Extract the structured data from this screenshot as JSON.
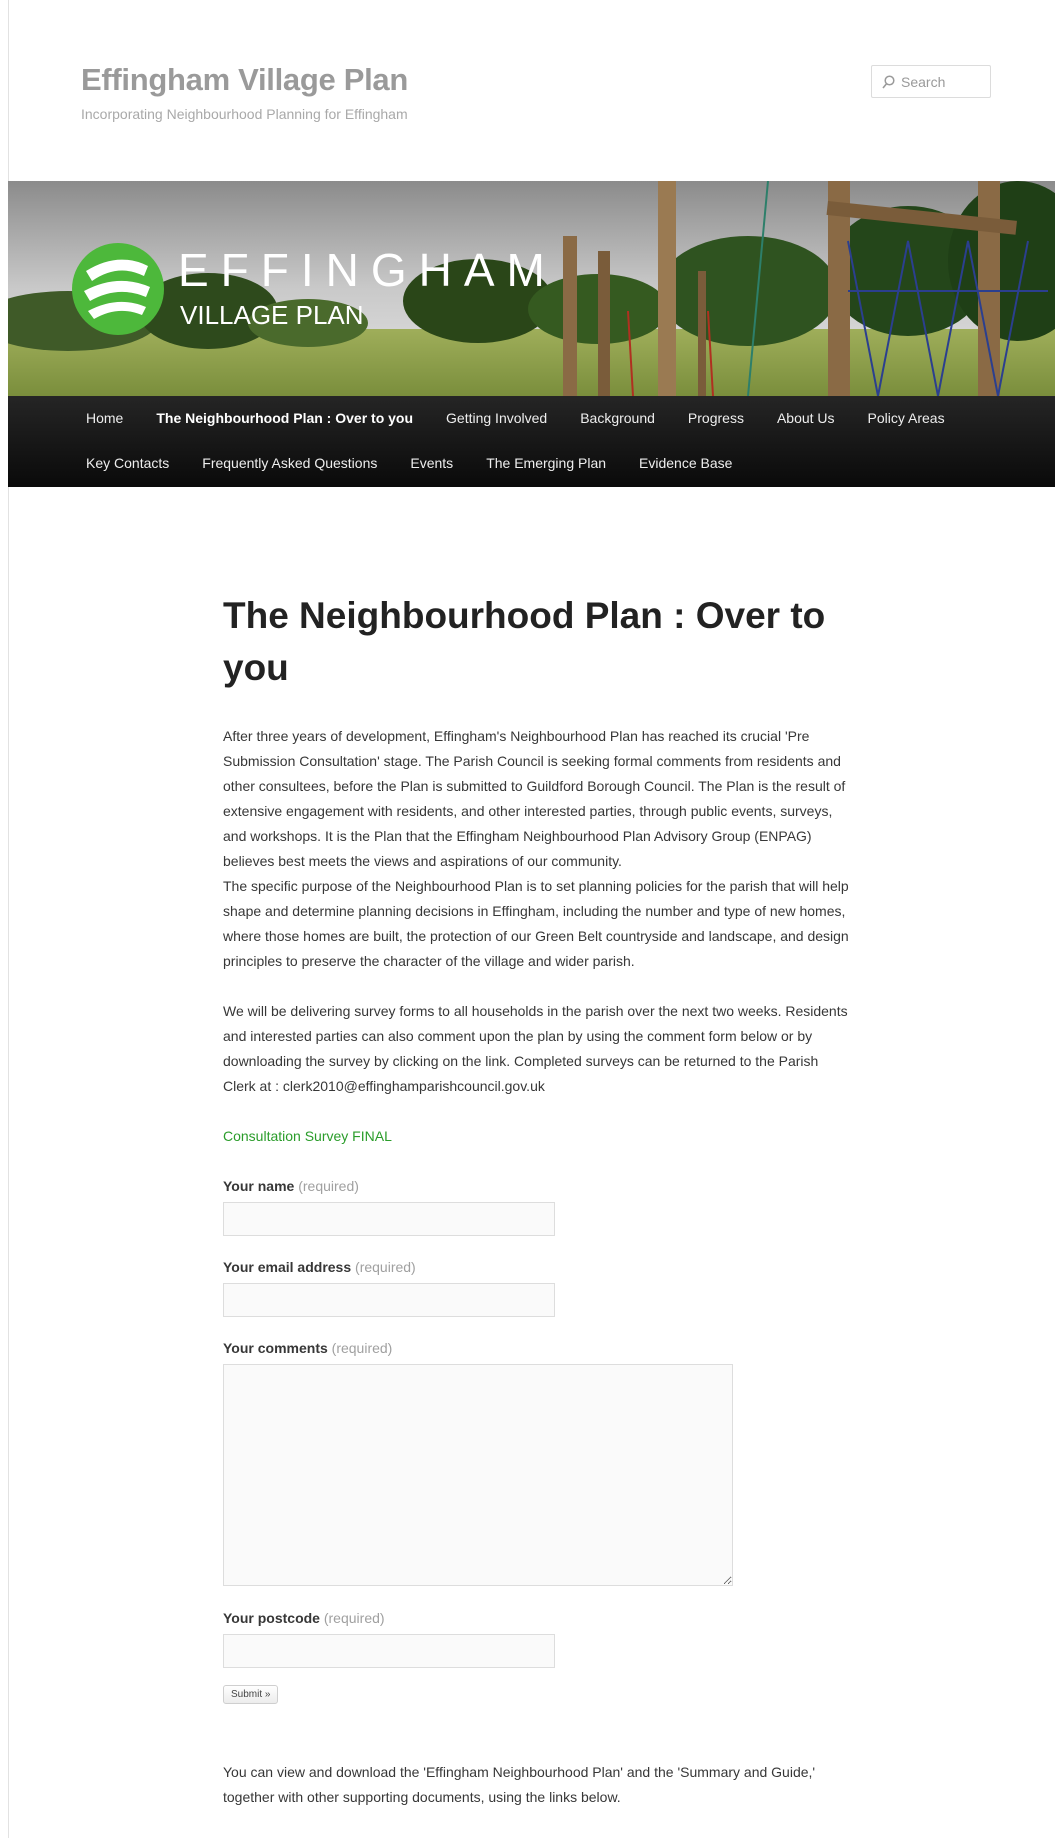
{
  "site": {
    "title": "Effingham Village Plan",
    "description": "Incorporating Neighbourhood Planning for Effingham"
  },
  "search": {
    "placeholder": "Search"
  },
  "banner": {
    "logo_top": "EFFINGHAM",
    "logo_bottom": "VILLAGE PLAN"
  },
  "nav": {
    "row1": [
      "Home",
      "The Neighbourhood Plan : Over to you",
      "Getting Involved",
      "Background",
      "Progress",
      "About Us",
      "Policy Areas"
    ],
    "row2": [
      "Key Contacts",
      "Frequently Asked Questions",
      "Events",
      "The Emerging Plan",
      "Evidence Base"
    ],
    "current": "The Neighbourhood Plan : Over to you"
  },
  "page": {
    "title": "The Neighbourhood Plan : Over to you",
    "para1": "After three years of development, Effingham's Neighbourhood Plan has reached its crucial 'Pre Submission Consultation' stage. The Parish Council is seeking formal comments from residents and other consultees, before the Plan is submitted to Guildford Borough Council. The Plan is the result of extensive engagement with residents, and other interested parties, through public events, surveys, and workshops. It is the Plan that the Effingham Neighbourhood Plan Advisory Group (ENPAG) believes best meets the views and aspirations of our community.",
    "para2": "The specific purpose of the Neighbourhood Plan is to set planning policies for the parish that will help shape and determine planning decisions in Effingham, including the number and type of new homes, where those homes are built, the protection of our Green Belt countryside and landscape, and design principles to preserve the character of the village and wider parish.",
    "para3": "We will be delivering survey forms to all households in the parish over the next two weeks. Residents and interested parties can also comment upon the plan by using the comment form below or by downloading the survey by clicking on the link. Completed surveys can be returned to the Parish Clerk at : clerk2010@effinghamparishcouncil.gov.uk",
    "survey_link": "Consultation Survey FINAL",
    "closing": "You can view and download the 'Effingham Neighbourhood Plan' and the 'Summary and Guide,' together with other supporting documents, using the links below."
  },
  "form": {
    "required_text": "(required)",
    "name_label": "Your name",
    "email_label": "Your email address",
    "comments_label": "Your comments",
    "postcode_label": "Your postcode",
    "name_value": "",
    "email_value": "",
    "comments_value": "",
    "postcode_value": "",
    "submit_label": "Submit »"
  },
  "colors": {
    "link": "#2a9c2a",
    "nav_bg": "#111111",
    "title_grey": "#9a9a9a"
  }
}
